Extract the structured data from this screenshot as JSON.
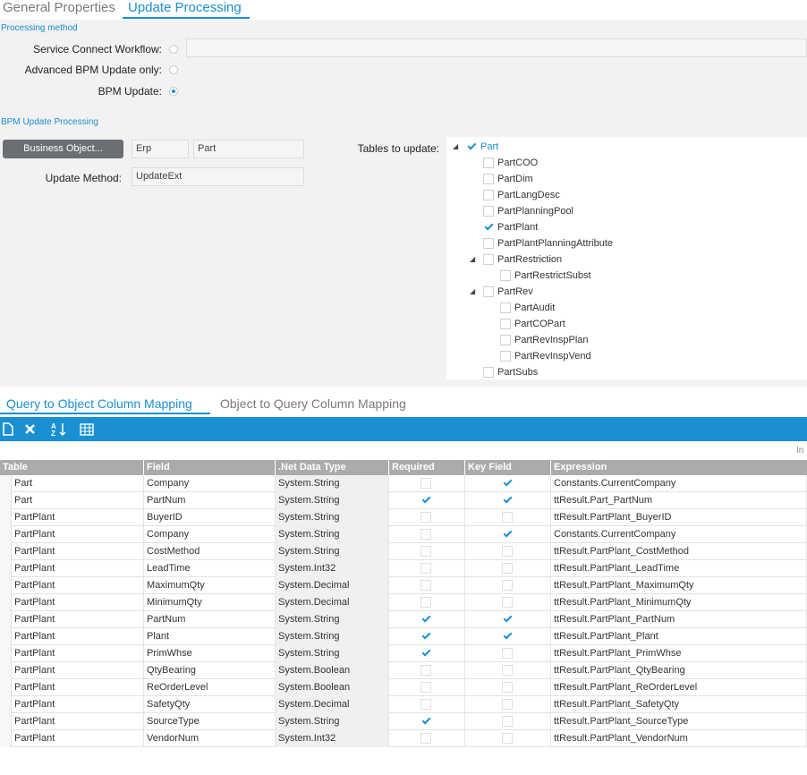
{
  "tabs": {
    "general": "General Properties",
    "update": "Update  Processing"
  },
  "processing": {
    "section": "Processing method",
    "service_connect": "Service Connect Workflow:",
    "advanced_bpm": "Advanced BPM Update only:",
    "bpm_update": "BPM Update:",
    "selected": "bpm_update",
    "workflow_value": ""
  },
  "bpm": {
    "section": "BPM Update Processing",
    "bo_button": "Business Object...",
    "bo_system": "Erp",
    "bo_name": "Part",
    "update_method_label": "Update Method:",
    "update_method": "UpdateExt",
    "tables_label": "Tables to update:"
  },
  "tree": [
    {
      "label": "Part",
      "level": 0,
      "expander": true,
      "checked": true,
      "blue": true
    },
    {
      "label": "PartCOO",
      "level": 1,
      "expander": false,
      "checked": false
    },
    {
      "label": "PartDim",
      "level": 1,
      "expander": false,
      "checked": false
    },
    {
      "label": "PartLangDesc",
      "level": 1,
      "expander": false,
      "checked": false
    },
    {
      "label": "PartPlanningPool",
      "level": 1,
      "expander": false,
      "checked": false
    },
    {
      "label": "PartPlant",
      "level": 1,
      "expander": false,
      "checked": true
    },
    {
      "label": "PartPlantPlanningAttribute",
      "level": 1,
      "expander": false,
      "checked": false
    },
    {
      "label": "PartRestriction",
      "level": 1,
      "expander": true,
      "checked": false
    },
    {
      "label": "PartRestrictSubst",
      "level": 2,
      "expander": false,
      "checked": false
    },
    {
      "label": "PartRev",
      "level": 1,
      "expander": true,
      "checked": false
    },
    {
      "label": "PartAudit",
      "level": 2,
      "expander": false,
      "checked": false
    },
    {
      "label": "PartCOPart",
      "level": 2,
      "expander": false,
      "checked": false
    },
    {
      "label": "PartRevInspPlan",
      "level": 2,
      "expander": false,
      "checked": false
    },
    {
      "label": "PartRevInspVend",
      "level": 2,
      "expander": false,
      "checked": false
    },
    {
      "label": "PartSubs",
      "level": 1,
      "expander": false,
      "checked": false
    }
  ],
  "mapping_tabs": {
    "q2o": "Query to Object Column Mapping",
    "o2q": "Object to Query Column Mapping"
  },
  "toolbar_icons": [
    "new-icon",
    "delete-icon",
    "sort-icon",
    "grid-settings-icon"
  ],
  "in_label": "In",
  "grid": {
    "headers": [
      "Table",
      "Field",
      ".Net Data Type",
      "Required",
      "Key Field",
      "Expression"
    ],
    "rows": [
      {
        "table": "Part",
        "field": "Company",
        "type": "System.String",
        "required": false,
        "key": true,
        "expr": "Constants.CurrentCompany"
      },
      {
        "table": "Part",
        "field": "PartNum",
        "type": "System.String",
        "required": true,
        "key": true,
        "expr": "ttResult.Part_PartNum"
      },
      {
        "table": "PartPlant",
        "field": "BuyerID",
        "type": "System.String",
        "required": false,
        "key": false,
        "expr": "ttResult.PartPlant_BuyerID"
      },
      {
        "table": "PartPlant",
        "field": "Company",
        "type": "System.String",
        "required": false,
        "key": true,
        "expr": "Constants.CurrentCompany"
      },
      {
        "table": "PartPlant",
        "field": "CostMethod",
        "type": "System.String",
        "required": false,
        "key": false,
        "expr": "ttResult.PartPlant_CostMethod"
      },
      {
        "table": "PartPlant",
        "field": "LeadTime",
        "type": "System.Int32",
        "required": false,
        "key": false,
        "expr": "ttResult.PartPlant_LeadTime"
      },
      {
        "table": "PartPlant",
        "field": "MaximumQty",
        "type": "System.Decimal",
        "required": false,
        "key": false,
        "expr": "ttResult.PartPlant_MaximumQty"
      },
      {
        "table": "PartPlant",
        "field": "MinimumQty",
        "type": "System.Decimal",
        "required": false,
        "key": false,
        "expr": "ttResult.PartPlant_MinimumQty"
      },
      {
        "table": "PartPlant",
        "field": "PartNum",
        "type": "System.String",
        "required": true,
        "key": true,
        "expr": "ttResult.PartPlant_PartNum"
      },
      {
        "table": "PartPlant",
        "field": "Plant",
        "type": "System.String",
        "required": true,
        "key": true,
        "expr": "ttResult.PartPlant_Plant"
      },
      {
        "table": "PartPlant",
        "field": "PrimWhse",
        "type": "System.String",
        "required": true,
        "key": false,
        "expr": "ttResult.PartPlant_PrimWhse"
      },
      {
        "table": "PartPlant",
        "field": "QtyBearing",
        "type": "System.Boolean",
        "required": false,
        "key": false,
        "expr": "ttResult.PartPlant_QtyBearing"
      },
      {
        "table": "PartPlant",
        "field": "ReOrderLevel",
        "type": "System.Boolean",
        "required": false,
        "key": false,
        "expr": "ttResult.PartPlant_ReOrderLevel"
      },
      {
        "table": "PartPlant",
        "field": "SafetyQty",
        "type": "System.Decimal",
        "required": false,
        "key": false,
        "expr": "ttResult.PartPlant_SafetyQty"
      },
      {
        "table": "PartPlant",
        "field": "SourceType",
        "type": "System.String",
        "required": true,
        "key": false,
        "expr": "ttResult.PartPlant_SourceType"
      },
      {
        "table": "PartPlant",
        "field": "VendorNum",
        "type": "System.Int32",
        "required": false,
        "key": false,
        "expr": "ttResult.PartPlant_VendorNum"
      }
    ]
  },
  "colors": {
    "accent": "#1a8fd1",
    "header_gray": "#ababab",
    "button_gray": "#6b6f73",
    "panel_bg": "#f2f2f2"
  }
}
